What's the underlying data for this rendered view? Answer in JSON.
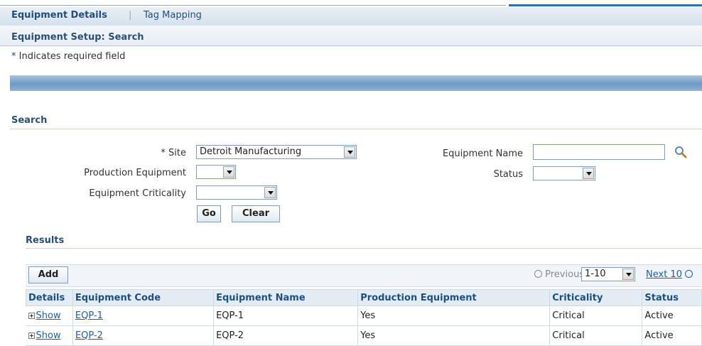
{
  "tabs": {
    "active": "Equipment Details",
    "separator": "|",
    "other": "Tag Mapping"
  },
  "page": {
    "title": "Equipment Setup: Search",
    "required_star": "*",
    "required_text": "Indicates required field"
  },
  "search": {
    "section_title": "Search",
    "site_label": "* Site",
    "site_value": "Detroit Manufacturing",
    "production_label": "Production Equipment",
    "production_value": "",
    "criticality_label": "Equipment Criticality",
    "criticality_value": "",
    "name_label": "Equipment Name",
    "name_value": "",
    "status_label": "Status",
    "status_value": "",
    "go_label": "Go",
    "clear_label": "Clear"
  },
  "results": {
    "title": "Results",
    "add_label": "Add",
    "previous_label": "Previous",
    "range_value": "1-10",
    "next_label": "Next 10",
    "columns": [
      "Details",
      "Equipment Code",
      "Equipment Name",
      "Production Equipment",
      "Criticality",
      "Status"
    ],
    "rows": [
      {
        "details": "Show",
        "code": "EQP-1",
        "name": "EQP-1",
        "production": "Yes",
        "criticality": "Critical",
        "status": "Active"
      },
      {
        "details": "Show",
        "code": "EQP-2",
        "name": "EQP-2",
        "production": "Yes",
        "criticality": "Critical",
        "status": "Active"
      }
    ]
  },
  "icons": {
    "search": "search-icon",
    "previous": "previous-arrow-icon",
    "next": "next-arrow-icon",
    "expand": "expand-plus-icon",
    "dropdown": "chevron-down-icon"
  },
  "colors": {
    "header_blue": "#2a4f78",
    "link": "#1f5ea8",
    "bar_blue": "#6e99c6"
  }
}
